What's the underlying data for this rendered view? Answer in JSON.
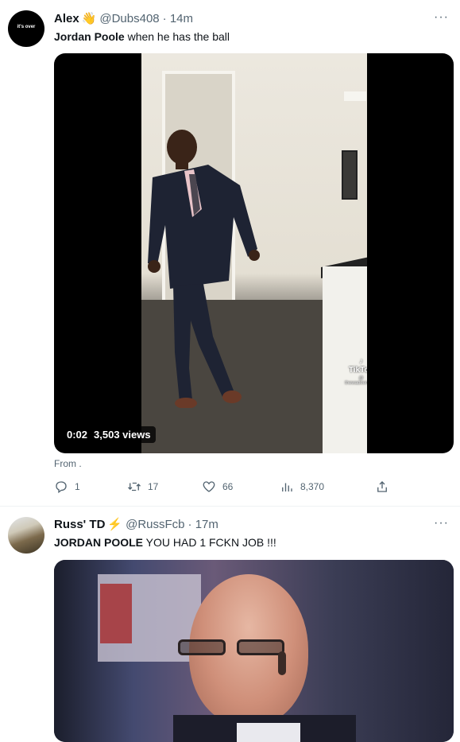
{
  "tweets": [
    {
      "avatar_text": "it's over",
      "name": "Alex",
      "emoji": "👋",
      "handle": "@Dubs408",
      "time": "· 14m",
      "text_bold": "Jordan Poole",
      "text_rest": " when he has the ball",
      "video": {
        "time": "0:02",
        "views": "3,503 views",
        "watermark_brand": "TikTok",
        "watermark_handle": "@ thewadeempire"
      },
      "from_label": "From .",
      "actions": {
        "replies": "1",
        "retweets": "17",
        "likes": "66",
        "views": "8,370"
      }
    },
    {
      "name": "Russ' TD",
      "emoji": "⚡",
      "handle": "@RussFcb",
      "time": "· 17m",
      "text_bold": "JORDAN POOLE",
      "text_rest": " YOU HAD 1 FCKN JOB !!!"
    }
  ],
  "more_label": "···",
  "icons": {
    "reply": "reply-icon",
    "retweet": "retweet-icon",
    "like": "heart-icon",
    "views": "analytics-icon",
    "share": "share-icon"
  },
  "colors": {
    "text": "#0f1419",
    "secondary": "#536471",
    "border": "#eff3f4"
  }
}
